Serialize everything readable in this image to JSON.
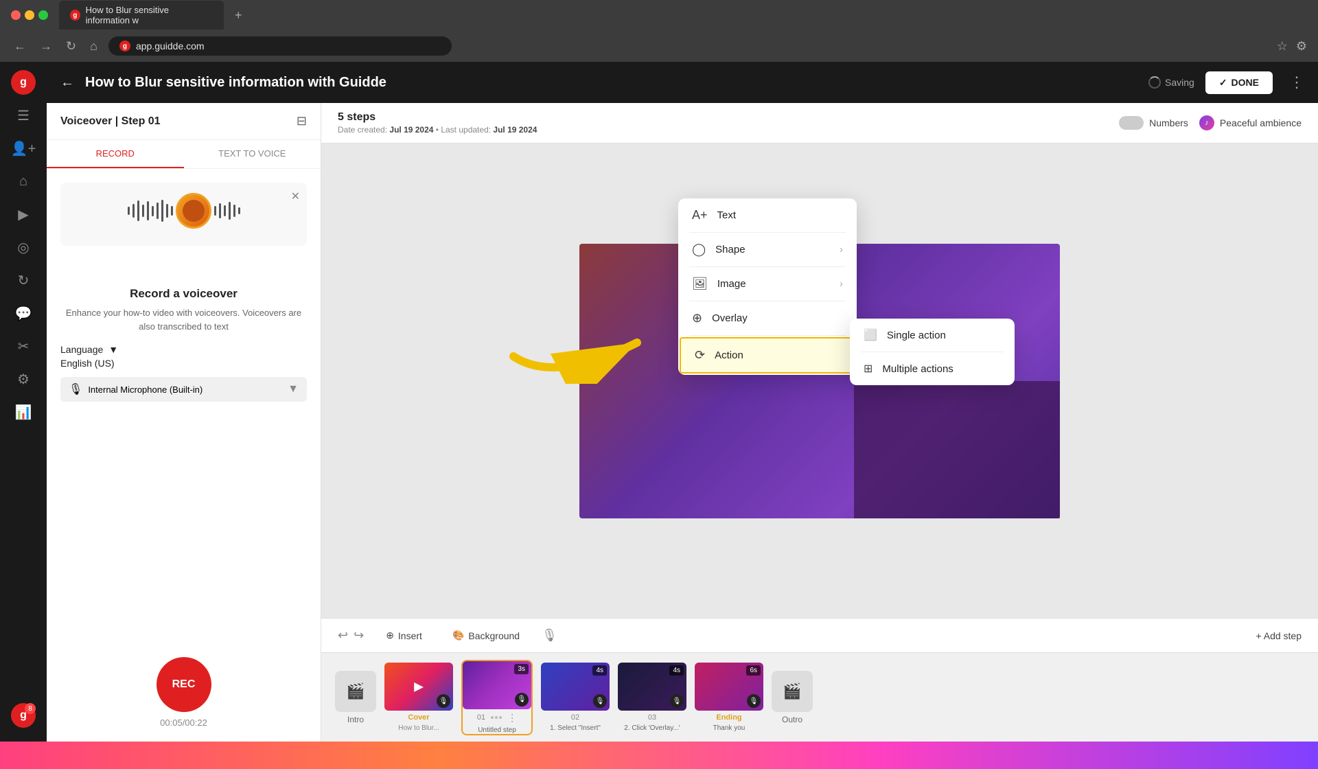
{
  "browser": {
    "tab_title": "How to Blur sensitive information w",
    "tab_new": "+",
    "address": "app.guidde.com",
    "nav_back": "←",
    "nav_forward": "→",
    "nav_refresh": "↻",
    "nav_home": "⌂"
  },
  "topbar": {
    "back_label": "←",
    "title": "How to Blur sensitive information with Guidde",
    "saving": "Saving",
    "done": "DONE"
  },
  "left_panel": {
    "title": "Voiceover | Step 01",
    "tab_record": "RECORD",
    "tab_tts": "TEXT TO VOICE",
    "record_title": "Record a voiceover",
    "record_desc": "Enhance your how-to video with voiceovers.\nVoiceovers are also transcribed to text",
    "language_label": "Language",
    "language_value": "English (US)",
    "mic_label": "Internal Microphone (Built-in)",
    "rec_label": "REC",
    "timer": "00:05/00:22"
  },
  "editor": {
    "steps_count": "5 steps",
    "date_created": "Jul 19 2024",
    "date_updated": "Jul 19 2024",
    "date_prefix": "Date created:",
    "updated_prefix": "• Last updated:",
    "numbers_label": "Numbers",
    "music_label": "Peaceful ambience"
  },
  "toolbar": {
    "insert": "Insert",
    "background": "Background",
    "add_step": "+ Add step"
  },
  "context_menu": {
    "text_item": "Text",
    "shape_item": "Shape",
    "image_item": "Image",
    "overlay_item": "Overlay",
    "action_item": "Action"
  },
  "submenu": {
    "single_action": "Single action",
    "multiple_actions": "Multiple actions"
  },
  "timeline": {
    "items": [
      {
        "label": "Intro",
        "type": "intro"
      },
      {
        "label": "Cover",
        "sublabel": "How to Blur...",
        "duration": "",
        "number": "",
        "type": "cover"
      },
      {
        "label": "Untitled step",
        "sublabel": "Untitled step",
        "duration": "3s",
        "number": "01",
        "type": "step01",
        "active": true
      },
      {
        "label": "1. Select \"Insert\"",
        "sublabel": "1. Select \"Insert\"",
        "duration": "4s",
        "number": "02",
        "type": "step02"
      },
      {
        "label": "2. Click 'Overlay...'",
        "sublabel": "2. Click 'Overlay...'",
        "duration": "4s",
        "number": "03",
        "type": "step03"
      },
      {
        "label": "Thank you",
        "sublabel": "Thank you",
        "duration": "6s",
        "number": "",
        "type": "ending"
      },
      {
        "label": "Outro",
        "type": "outro"
      }
    ]
  },
  "sidebar_icons": {
    "menu": "☰",
    "users": "👤",
    "home": "⌂",
    "video": "▶",
    "circle": "◎",
    "refresh": "↻",
    "chat": "💬",
    "tools": "✂",
    "puzzle": "⚙",
    "chart": "📊",
    "badge_count": "8"
  }
}
